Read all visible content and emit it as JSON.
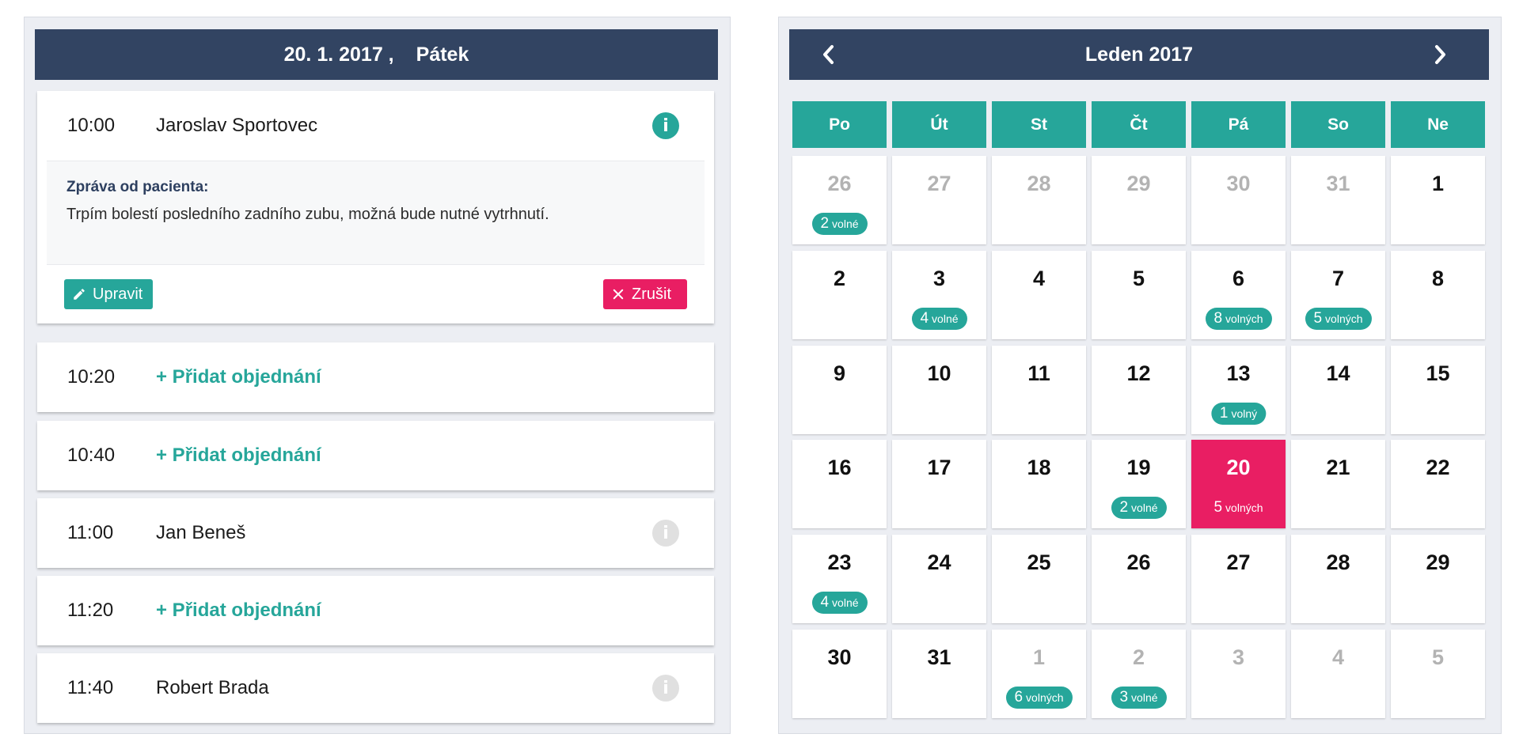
{
  "day_view": {
    "date": "20. 1. 2017 ,",
    "weekday": "Pátek",
    "slots": [
      {
        "time": "10:00",
        "name": "Jaroslav Sportovec",
        "info": "i"
      },
      {
        "time": "10:20",
        "add_label": "+ Přidat objednání"
      },
      {
        "time": "10:40",
        "add_label": "+ Přidat objednání"
      },
      {
        "time": "11:00",
        "name": "Jan Beneš",
        "info": "i"
      },
      {
        "time": "11:20",
        "add_label": "+ Přidat objednání"
      },
      {
        "time": "11:40",
        "name": "Robert Brada",
        "info": "i"
      }
    ],
    "message_label": "Zpráva od pacienta:",
    "message_text": "Trpím bolestí posledního zadního zubu, možná bude nutné vytrhnutí.",
    "edit_label": "Upravit",
    "cancel_label": "Zrušit"
  },
  "calendar": {
    "title": "Leden 2017",
    "weekdays": [
      "Po",
      "Út",
      "St",
      "Čt",
      "Pá",
      "So",
      "Ne"
    ],
    "weeks": [
      [
        {
          "d": "26",
          "other": true,
          "free": "2",
          "free_label": "volné"
        },
        {
          "d": "27",
          "other": true
        },
        {
          "d": "28",
          "other": true
        },
        {
          "d": "29",
          "other": true
        },
        {
          "d": "30",
          "other": true
        },
        {
          "d": "31",
          "other": true
        },
        {
          "d": "1"
        }
      ],
      [
        {
          "d": "2"
        },
        {
          "d": "3",
          "free": "4",
          "free_label": "volné"
        },
        {
          "d": "4"
        },
        {
          "d": "5"
        },
        {
          "d": "6",
          "free": "8",
          "free_label": "volných"
        },
        {
          "d": "7",
          "free": "5",
          "free_label": "volných"
        },
        {
          "d": "8"
        }
      ],
      [
        {
          "d": "9"
        },
        {
          "d": "10"
        },
        {
          "d": "11"
        },
        {
          "d": "12"
        },
        {
          "d": "13",
          "free": "1",
          "free_label": "volný"
        },
        {
          "d": "14"
        },
        {
          "d": "15"
        }
      ],
      [
        {
          "d": "16"
        },
        {
          "d": "17"
        },
        {
          "d": "18"
        },
        {
          "d": "19",
          "free": "2",
          "free_label": "volné"
        },
        {
          "d": "20",
          "selected": true,
          "free": "5",
          "free_label": "volných"
        },
        {
          "d": "21"
        },
        {
          "d": "22"
        }
      ],
      [
        {
          "d": "23",
          "free": "4",
          "free_label": "volné"
        },
        {
          "d": "24"
        },
        {
          "d": "25"
        },
        {
          "d": "26"
        },
        {
          "d": "27"
        },
        {
          "d": "28"
        },
        {
          "d": "29"
        }
      ],
      [
        {
          "d": "30"
        },
        {
          "d": "31"
        },
        {
          "d": "1",
          "other": true,
          "free": "6",
          "free_label": "volných"
        },
        {
          "d": "2",
          "other": true,
          "free": "3",
          "free_label": "volné"
        },
        {
          "d": "3",
          "other": true
        },
        {
          "d": "4",
          "other": true
        },
        {
          "d": "5",
          "other": true
        }
      ]
    ]
  },
  "colors": {
    "header": "#324462",
    "accent": "#26a69a",
    "danger": "#e91e63",
    "muted_icon": "#e0e0e0"
  }
}
